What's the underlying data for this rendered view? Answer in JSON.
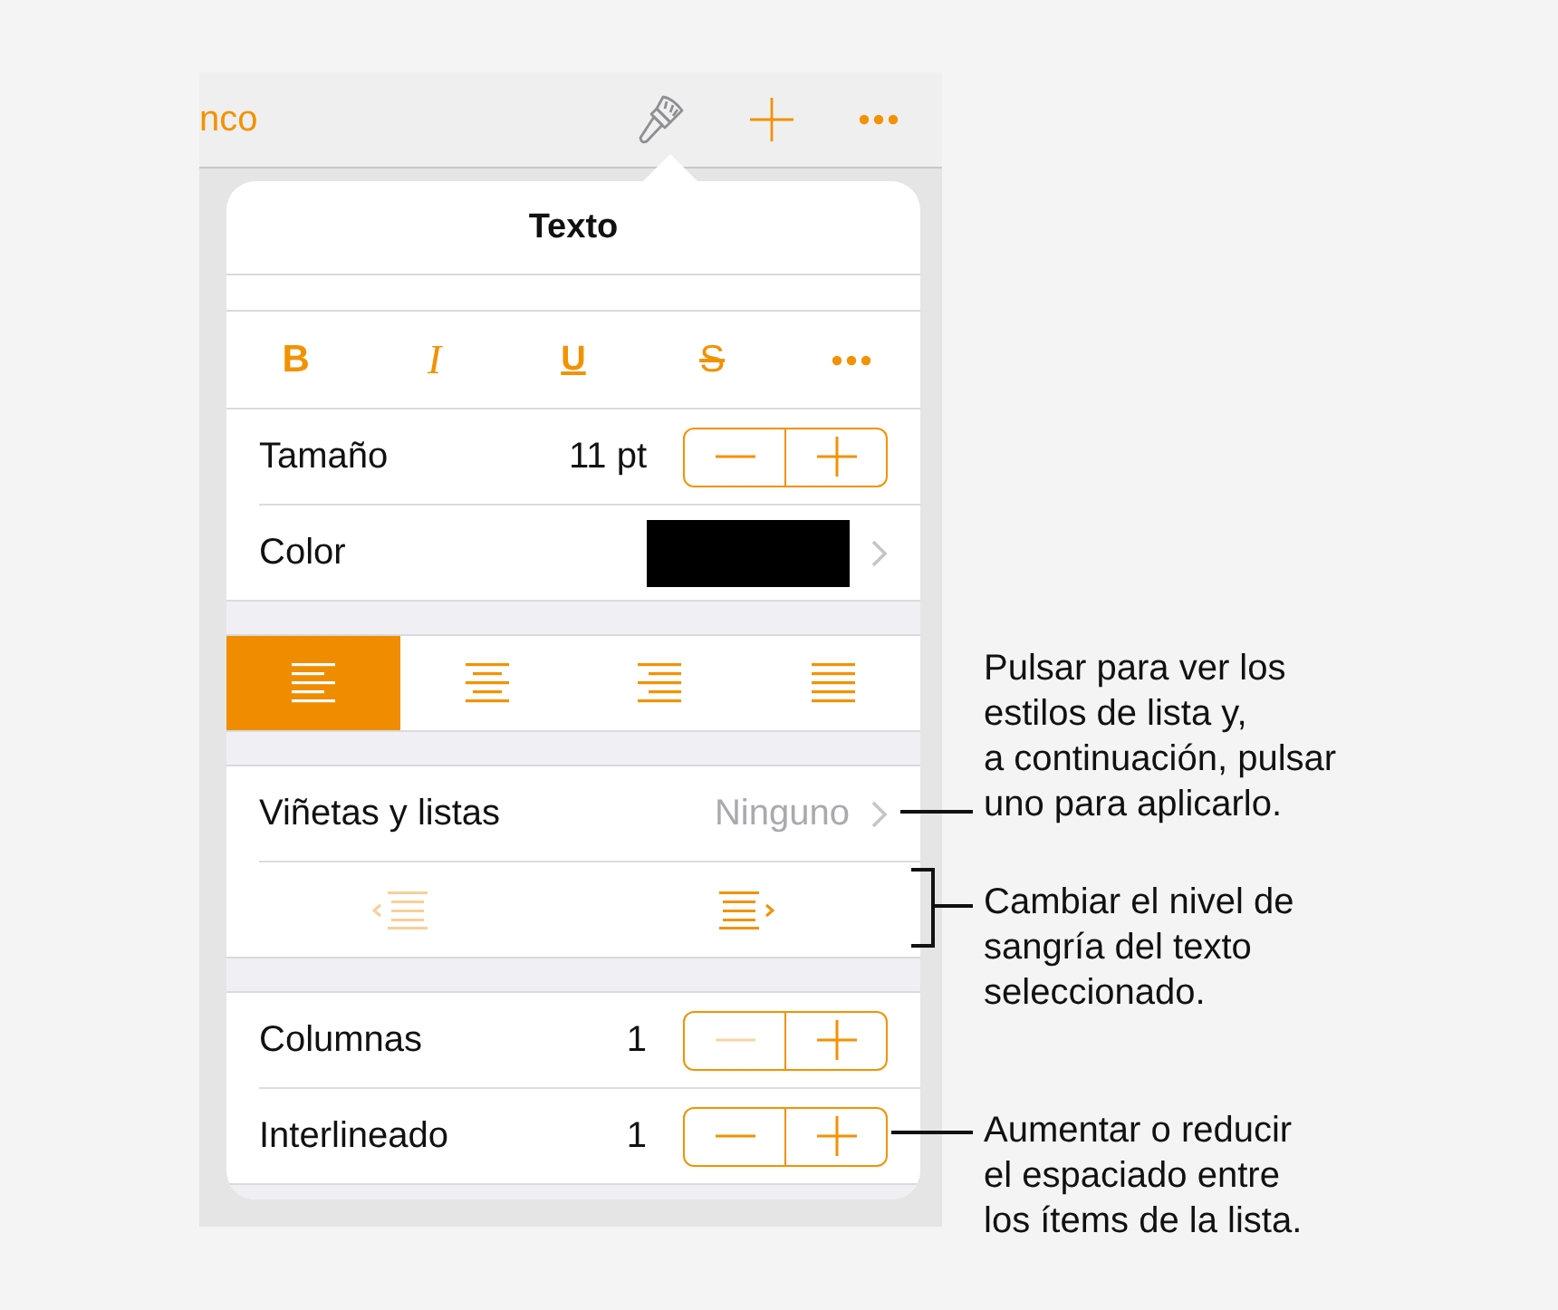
{
  "toolbar": {
    "back_label": "nco",
    "tools": [
      {
        "kind": "brush",
        "selected": true
      },
      {
        "kind": "add",
        "selected": false
      },
      {
        "kind": "more",
        "selected": false
      }
    ]
  },
  "popover": {
    "title": "Texto",
    "sections": [
      {
        "rows": [
          {
            "kind": "styles",
            "buttons": [
              {
                "kind": "bold",
                "label": "B"
              },
              {
                "kind": "italic",
                "label": "I"
              },
              {
                "kind": "underline",
                "label": "U"
              },
              {
                "kind": "strike",
                "label": "S"
              },
              {
                "kind": "more"
              }
            ]
          },
          {
            "kind": "stepper",
            "label": "Tamaño",
            "value": "11 pt",
            "decrease_disabled": false
          },
          {
            "kind": "color",
            "label": "Color",
            "color": "#000000"
          }
        ]
      },
      {
        "rows": [
          {
            "kind": "alignment",
            "options": [
              {
                "kind": "left",
                "selected": true
              },
              {
                "kind": "center",
                "selected": false
              },
              {
                "kind": "right",
                "selected": false
              },
              {
                "kind": "justify",
                "selected": false
              }
            ]
          }
        ]
      },
      {
        "rows": [
          {
            "kind": "disclosure",
            "label": "Viñetas y listas",
            "value": "Ninguno"
          },
          {
            "kind": "indent",
            "outdent_disabled": true,
            "indent_disabled": false
          }
        ]
      },
      {
        "rows": [
          {
            "kind": "stepper",
            "label": "Columnas",
            "value": "1",
            "decrease_disabled": true
          },
          {
            "kind": "stepper",
            "label": "Interlineado",
            "value": "1",
            "decrease_disabled": false
          }
        ]
      }
    ]
  },
  "callouts": [
    {
      "kind": "line",
      "text": "Pulsar para ver los\nestilos de lista y,\na continuación, pulsar\nuno para aplicarlo."
    },
    {
      "kind": "bracket",
      "text": "Cambiar el nivel de\nsangría del texto\nseleccionado."
    },
    {
      "kind": "line",
      "text": "Aumentar o reducir\nel espaciado entre\nlos ítems de la lista."
    }
  ]
}
